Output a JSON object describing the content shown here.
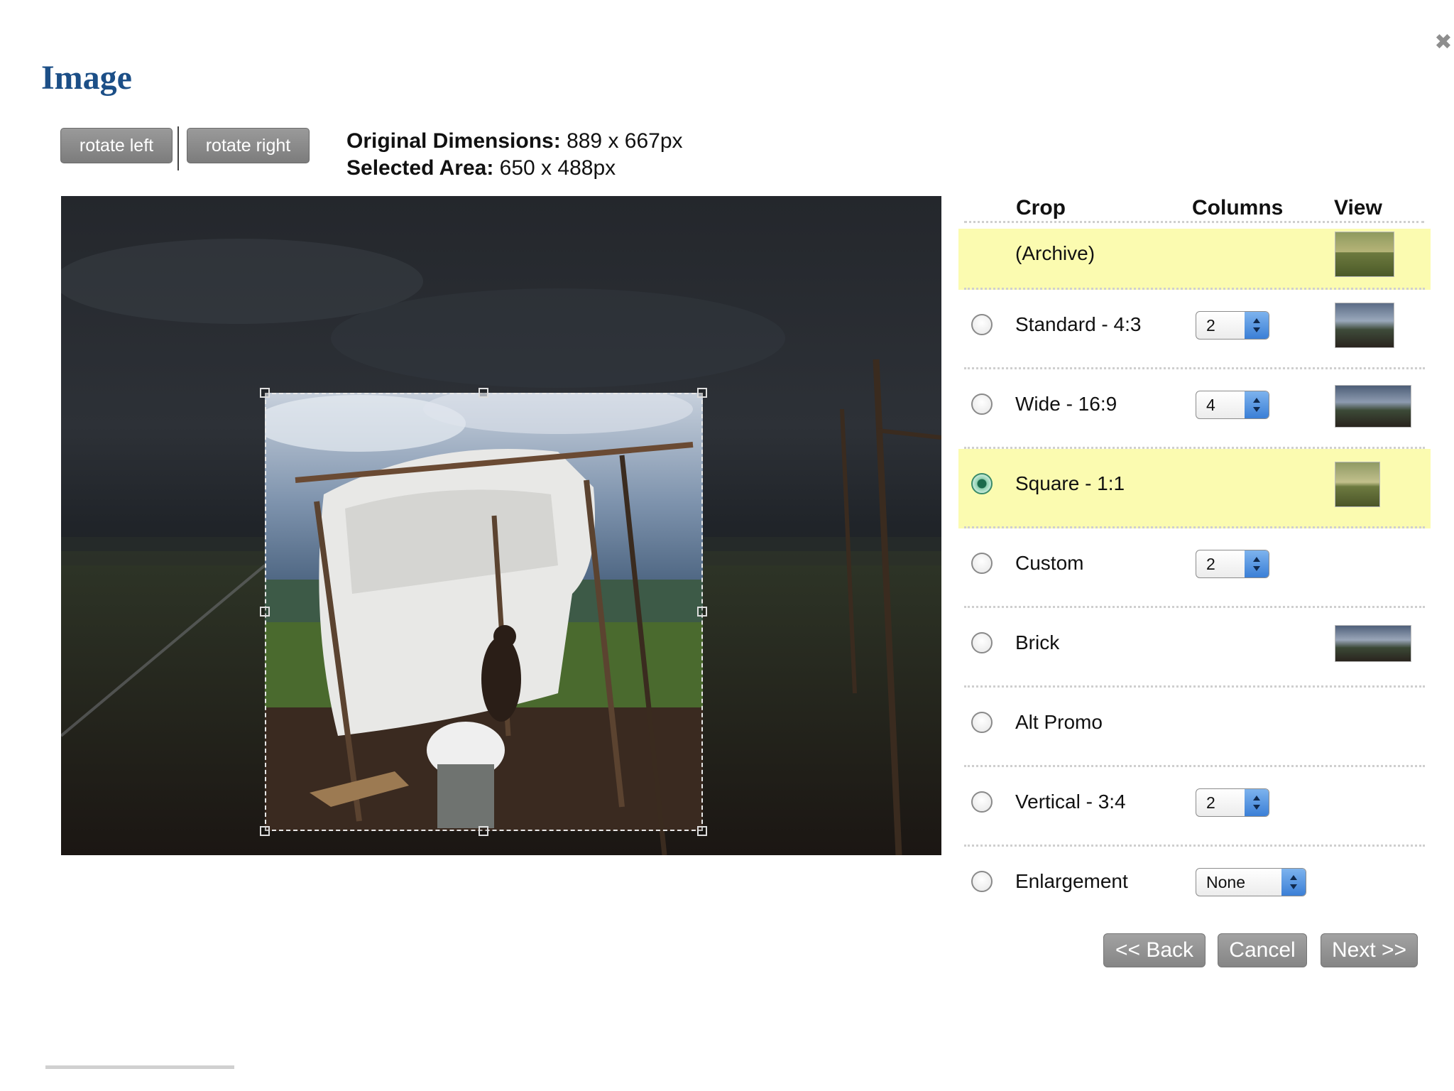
{
  "dialog": {
    "title": "Image",
    "close_label": "✖"
  },
  "toolbar": {
    "rotate_left": "rotate left",
    "rotate_right": "rotate right"
  },
  "dimensions": {
    "original_label": "Original Dimensions:",
    "original_value": "889 x 667px",
    "selected_label": "Selected Area:",
    "selected_value": "650 x 488px"
  },
  "table": {
    "headers": {
      "crop": "Crop",
      "columns": "Columns",
      "view": "View"
    },
    "rows": [
      {
        "label": "(Archive)",
        "highlighted": true,
        "radio": false,
        "columns": null,
        "thumb": "wide"
      },
      {
        "label": "Standard - 4:3",
        "highlighted": false,
        "radio": true,
        "checked": false,
        "columns": "2",
        "thumb": "standard"
      },
      {
        "label": "Wide - 16:9",
        "highlighted": false,
        "radio": true,
        "checked": false,
        "columns": "4",
        "thumb": "wide16"
      },
      {
        "label": "Square - 1:1",
        "highlighted": true,
        "radio": true,
        "checked": true,
        "columns": null,
        "thumb": "square"
      },
      {
        "label": "Custom",
        "highlighted": false,
        "radio": true,
        "checked": false,
        "columns": "2",
        "thumb": null
      },
      {
        "label": "Brick",
        "highlighted": false,
        "radio": true,
        "checked": false,
        "columns": null,
        "thumb": "brick"
      },
      {
        "label": "Alt Promo",
        "highlighted": false,
        "radio": true,
        "checked": false,
        "columns": null,
        "thumb": null
      },
      {
        "label": "Vertical - 3:4",
        "highlighted": false,
        "radio": true,
        "checked": false,
        "columns": "2",
        "thumb": null
      },
      {
        "label": "Enlargement",
        "highlighted": false,
        "radio": true,
        "checked": false,
        "columns": "None",
        "thumb": null
      }
    ]
  },
  "buttons": {
    "back": "<< Back",
    "cancel": "Cancel",
    "next": "Next >>"
  },
  "colors": {
    "title": "#1c4f87",
    "highlight_row": "#fbfbb0",
    "button_gray": "#8a8a8a"
  }
}
